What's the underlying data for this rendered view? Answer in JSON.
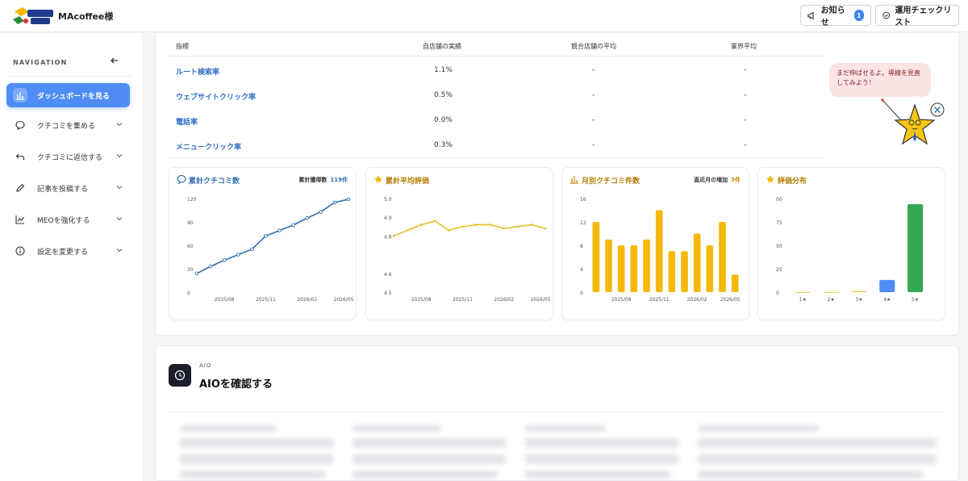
{
  "header": {
    "brand": "MAcoffee様",
    "notify_label": "お知らせ",
    "notify_count": "1",
    "checklist_label": "運用チェックリスト"
  },
  "sidebar": {
    "heading": "NAVIGATION",
    "items": [
      {
        "label": "ダッシュボードを見る",
        "icon": "bar-chart-icon",
        "active": true
      },
      {
        "label": "クチコミを集める",
        "icon": "chat-icon"
      },
      {
        "label": "クチコミに返信する",
        "icon": "reply-icon"
      },
      {
        "label": "記事を投稿する",
        "icon": "pencil-icon"
      },
      {
        "label": "MEOを強化する",
        "icon": "trend-icon"
      },
      {
        "label": "設定を変更する",
        "icon": "info-icon"
      }
    ]
  },
  "metrics_table": {
    "headers": [
      "指標",
      "自店舗の実績",
      "競合店舗の平均",
      "業界平均"
    ],
    "rows": [
      {
        "label": "ルート検索率",
        "own": "1.1%",
        "competitor": "-",
        "industry": "-"
      },
      {
        "label": "ウェブサイトクリック率",
        "own": "0.5%",
        "competitor": "-",
        "industry": "-"
      },
      {
        "label": "電話率",
        "own": "0.0%",
        "competitor": "-",
        "industry": "-"
      },
      {
        "label": "メニュークリック率",
        "own": "0.3%",
        "competitor": "-",
        "industry": "-"
      }
    ]
  },
  "mascot": {
    "bubble_text": "まだ伸ばせるよ。導線を見直してみよう！"
  },
  "cards": {
    "cumulative": {
      "title": "累計クチコミ数",
      "right_label": "累計獲得数",
      "right_value": "119件",
      "color": "#2f6fb0"
    },
    "avg_rating": {
      "title": "累計平均評価",
      "color": "#e5c02a"
    },
    "monthly": {
      "title": "月別クチコミ件数",
      "right_label": "直近月の増加",
      "right_value": "3件",
      "color": "#f5b80a"
    },
    "distribution": {
      "title": "評価分布"
    }
  },
  "chart_data": [
    {
      "type": "line",
      "title": "累計クチコミ数",
      "x_ticks": [
        "2025/08",
        "2025/11",
        "2026/02",
        "2026/05"
      ],
      "y_ticks": [
        "0",
        "30",
        "60",
        "90",
        "120"
      ],
      "ylim": [
        0,
        120
      ],
      "values": [
        24,
        33,
        41,
        48,
        55,
        72,
        79,
        86,
        95,
        103,
        115,
        119
      ]
    },
    {
      "type": "line",
      "title": "累計平均評価",
      "x_ticks": [
        "2025/08",
        "2025/11",
        "2026/02",
        "2026/05"
      ],
      "y_ticks": [
        "4.5",
        "4.6",
        "4.8",
        "4.9",
        "5.0"
      ],
      "ylim": [
        4.5,
        5.0
      ],
      "values": [
        4.8,
        4.83,
        4.86,
        4.88,
        4.83,
        4.85,
        4.86,
        4.86,
        4.84,
        4.85,
        4.86,
        4.84
      ]
    },
    {
      "type": "bar",
      "title": "月別クチコミ件数",
      "x_ticks": [
        "2025/08",
        "2025/11",
        "2026/02",
        "2026/05"
      ],
      "y_ticks": [
        "0",
        "4",
        "8",
        "12",
        "16"
      ],
      "ylim": [
        0,
        16
      ],
      "values": [
        12,
        9,
        8,
        8,
        9,
        14,
        7,
        7,
        10,
        8,
        12,
        3
      ]
    },
    {
      "type": "bar",
      "title": "評価分布",
      "categories": [
        "1★",
        "2★",
        "3★",
        "4★",
        "5★"
      ],
      "y_ticks": [
        "0",
        "25",
        "50",
        "75",
        "00"
      ],
      "ylim": [
        0,
        100
      ],
      "values": [
        0,
        0,
        1,
        13,
        94
      ],
      "colors": [
        "#f0c419",
        "#f0c419",
        "#f0c419",
        "#4f8df5",
        "#34a853"
      ]
    }
  ],
  "aio": {
    "tag": "AIO",
    "title": "AIOを確認する"
  }
}
